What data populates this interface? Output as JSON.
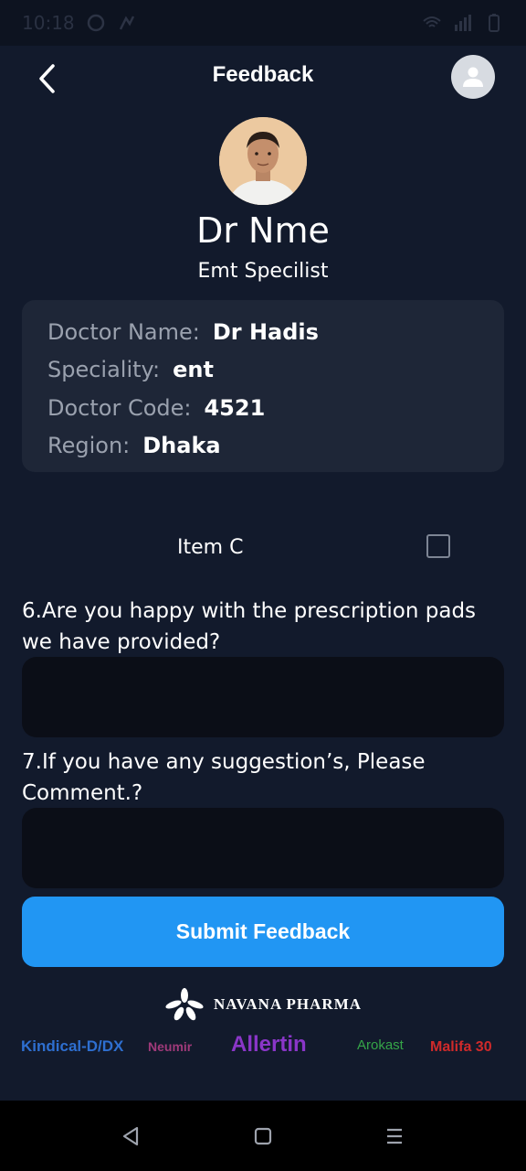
{
  "status_bar": {
    "time": "10:18",
    "icons": [
      "whatsapp-icon",
      "network-icon",
      "wifi-icon",
      "signal-icon",
      "battery-icon"
    ]
  },
  "header": {
    "title": "Feedback",
    "back_icon": "chevron-left-icon",
    "profile_icon": "person-icon"
  },
  "doctor": {
    "name": "Dr Nme",
    "specialty": "Emt Specilist"
  },
  "info_card": {
    "rows": [
      {
        "label": "Doctor Name:",
        "value": "Dr Hadis"
      },
      {
        "label": "Speciality:",
        "value": "ent"
      },
      {
        "label": "Doctor Code:",
        "value": "4521"
      },
      {
        "label": "Region:",
        "value": "Dhaka"
      }
    ]
  },
  "item_row": {
    "label": "Item C",
    "checked": false
  },
  "questions": [
    {
      "text": "6.Are you happy with the prescription pads we have provided?",
      "answer": ""
    },
    {
      "text": "7.If you have any suggestion’s, Please Comment.?",
      "answer": ""
    }
  ],
  "submit_label": "Submit Feedback",
  "company": {
    "name": "NAVANA PHARMA"
  },
  "brands": [
    "Kindical-D/DX",
    "Neumir",
    "Allertin",
    "Arokast",
    "Malifa 30"
  ],
  "colors": {
    "background": "#121a2c",
    "card": "#1e2637",
    "input": "#0b0e17",
    "accent": "#2196f3"
  }
}
